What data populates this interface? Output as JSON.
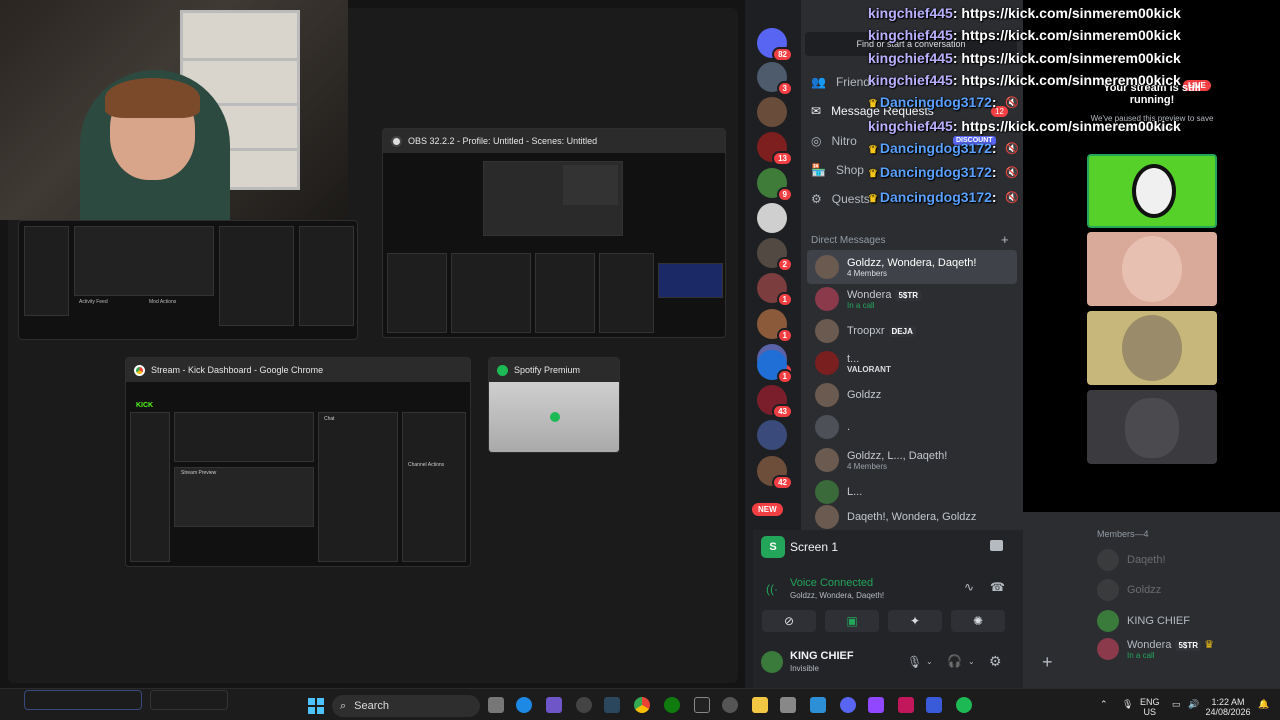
{
  "task_view": {
    "windows": [
      {
        "title": "OBS 32.2.2 - Profile: Untitled - Scenes: Untitled"
      },
      {
        "title": "Stream - Kick Dashboard - Google Chrome"
      },
      {
        "title": "Spotify Premium"
      }
    ],
    "thumb_text": {
      "kick": "KICK",
      "activity_feed": "Activity Feed",
      "mod_actions": "Mod Actions",
      "stream_preview": "Stream Preview",
      "chat": "Chat",
      "channel_actions": "Channel Actions"
    }
  },
  "discord": {
    "server_badges": [
      "82",
      "3",
      "13",
      "9",
      "2",
      "1",
      "1",
      "4",
      "1",
      "43",
      "42",
      "NEW"
    ],
    "search_placeholder": "Find or start a conversation",
    "nav": [
      {
        "label": "Friends",
        "icon": "friends-icon"
      },
      {
        "label": "Message Requests",
        "icon": "mail-icon",
        "badge": "12"
      },
      {
        "label": "Nitro",
        "icon": "nitro-icon"
      },
      {
        "label": "Shop",
        "icon": "shop-icon",
        "badge": "DISCOUNT"
      },
      {
        "label": "Quests",
        "icon": "quests-icon"
      }
    ],
    "dm_header": "Direct Messages",
    "dms": [
      {
        "name": "Goldzz, Wondera, Daqeth!",
        "sub": "4 Members"
      },
      {
        "name": "Wondera",
        "tag": "5$TR",
        "sub": "In a call"
      },
      {
        "name": "Troopxr",
        "tag": "DEJA",
        "sub": ""
      },
      {
        "name": "t...",
        "sub": "VALORANT"
      },
      {
        "name": "Goldzz",
        "sub": ""
      },
      {
        "name": ".",
        "sub": ""
      },
      {
        "name": "Goldzz, L..., Daqeth!",
        "sub": "4 Members"
      },
      {
        "name": "L...",
        "sub": ""
      },
      {
        "name": "Daqeth!, Wondera, Goldzz",
        "sub": ""
      }
    ],
    "screen_label": "Screen 1",
    "voice_status": "Voice Connected",
    "voice_members": "Goldzz, Wondera, Daqeth!",
    "user_name": "KING CHIEF",
    "user_status": "Invisible",
    "stream_paused": {
      "live": "LIVE",
      "title": "Your stream is still running!",
      "body": "We've paused this preview to save your resources."
    },
    "members_header": "Members—4",
    "members": [
      {
        "name": "Daqeth!",
        "faded": true
      },
      {
        "name": "Goldzz",
        "faded": true
      },
      {
        "name": "KING CHIEF",
        "faded": false
      },
      {
        "name": "Wondera",
        "tag": "5$TR",
        "sub": "In a call",
        "faded": false
      }
    ]
  },
  "chat_overlay": [
    {
      "user": "kingchief445",
      "msg": "https://kick.com/sinmerem00kick"
    },
    {
      "user": "kingchief445",
      "msg": "https://kick.com/sinmerem00kick"
    },
    {
      "user": "kingchief445",
      "msg": "https://kick.com/sinmerem00kick"
    },
    {
      "user": "kingchief445",
      "msg": "https://kick.com/sinmerem00kick"
    },
    {
      "user": "Dancingdog3172",
      "msg": ""
    },
    {
      "user": "kingchief445",
      "msg": "https://kick.com/sinmerem00kick"
    },
    {
      "user": "Dancingdog3172",
      "msg": ""
    },
    {
      "user": "Dancingdog3172",
      "msg": ""
    },
    {
      "user": "Dancingdog3172",
      "msg": ""
    }
  ],
  "taskbar": {
    "search_label": "Search",
    "language": "ENG",
    "region": "US",
    "time": "1:22 AM",
    "date": "24/08/2026"
  }
}
